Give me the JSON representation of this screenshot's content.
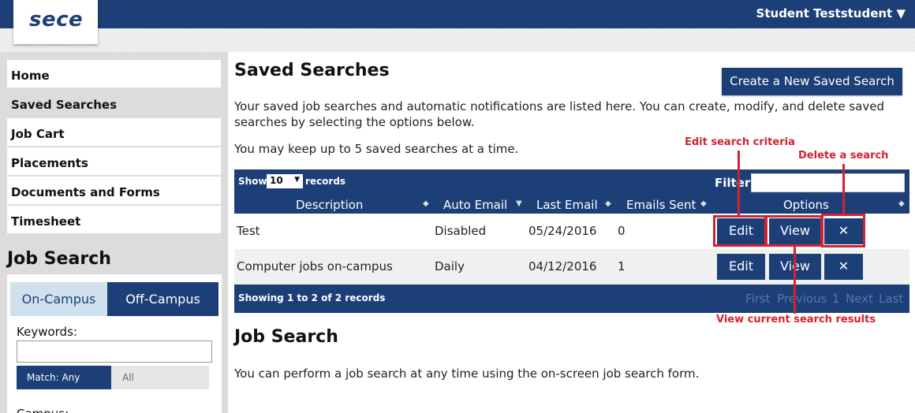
{
  "header": {
    "logo": "sece",
    "user_name": "Student Teststudent ▼"
  },
  "sidebar": {
    "items": [
      {
        "label": "Home"
      },
      {
        "label": "Saved Searches"
      },
      {
        "label": "Job Cart"
      },
      {
        "label": "Placements"
      },
      {
        "label": "Documents and Forms"
      },
      {
        "label": "Timesheet"
      }
    ],
    "active": "Saved Searches",
    "job_search": {
      "title": "Job Search",
      "tabs": [
        "On-Campus",
        "Off-Campus"
      ],
      "keywords_label": "Keywords:",
      "keywords_value": "",
      "match_any": "Match: Any",
      "match_all": "All",
      "campus_label": "Campus:"
    }
  },
  "main": {
    "title": "Saved Searches",
    "create_button": "Create a New Saved Search",
    "intro": "Your saved job searches and automatic notifications are listed here. You can create, modify, and delete saved searches by selecting the options below.",
    "limit_note": "You may keep up to 5 saved searches at a time.",
    "table": {
      "show_label": "Show",
      "show_value": "10",
      "records_label": "records",
      "filter_label": "Filter:",
      "filter_value": "",
      "columns": [
        "Description",
        "Auto Email",
        "Last Email",
        "Emails Sent",
        "Options"
      ],
      "rows": [
        {
          "description": "Test",
          "auto_email": "Disabled",
          "last_email": "05/24/2016",
          "emails_sent": "0"
        },
        {
          "description": "Computer jobs on-campus",
          "auto_email": "Daily",
          "last_email": "04/12/2016",
          "emails_sent": "1"
        }
      ],
      "row_buttons": {
        "edit": "Edit",
        "view": "View",
        "delete": "✕"
      },
      "footer_info": "Showing 1 to 2 of 2 records",
      "pager": [
        "First",
        "Previous",
        "1",
        "Next",
        "Last"
      ]
    },
    "job_search_title": "Job Search",
    "job_search_text": "You can perform a job search at any time using the on-screen job search form."
  },
  "annotations": {
    "edit": "Edit search criteria",
    "delete": "Delete a search",
    "view": "View current search results",
    "color": "#d3232f"
  },
  "colors": {
    "brand": "#1c3f77",
    "tab_active": "#d0e1ee",
    "sidebar_bg": "#dcdcdc"
  }
}
